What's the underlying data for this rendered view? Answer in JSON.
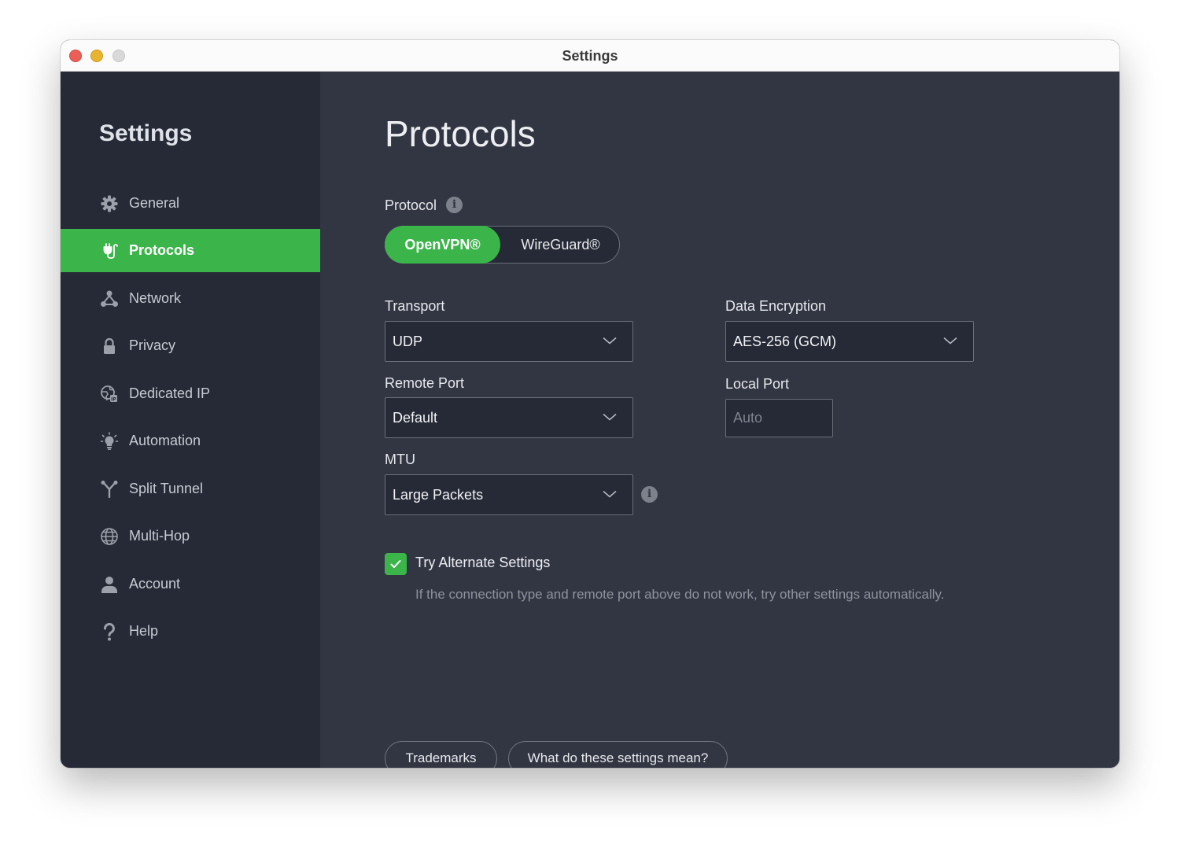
{
  "window": {
    "title": "Settings"
  },
  "sidebar": {
    "title": "Settings",
    "items": [
      {
        "label": "General",
        "icon": "gear-icon"
      },
      {
        "label": "Protocols",
        "icon": "plug-icon",
        "active": true
      },
      {
        "label": "Network",
        "icon": "network-icon"
      },
      {
        "label": "Privacy",
        "icon": "lock-icon"
      },
      {
        "label": "Dedicated IP",
        "icon": "dedicated-ip-icon"
      },
      {
        "label": "Automation",
        "icon": "lightbulb-icon"
      },
      {
        "label": "Split Tunnel",
        "icon": "split-icon"
      },
      {
        "label": "Multi-Hop",
        "icon": "globe-icon"
      },
      {
        "label": "Account",
        "icon": "user-icon"
      },
      {
        "label": "Help",
        "icon": "question-icon"
      }
    ]
  },
  "main": {
    "title": "Protocols",
    "protocol": {
      "label": "Protocol",
      "options": [
        "OpenVPN®",
        "WireGuard®"
      ],
      "selected": "OpenVPN®"
    },
    "transport": {
      "label": "Transport",
      "value": "UDP"
    },
    "data_encryption": {
      "label": "Data Encryption",
      "value": "AES-256 (GCM)"
    },
    "remote_port": {
      "label": "Remote Port",
      "value": "Default"
    },
    "local_port": {
      "label": "Local Port",
      "placeholder": "Auto"
    },
    "mtu": {
      "label": "MTU",
      "value": "Large Packets"
    },
    "alternate": {
      "label": "Try Alternate Settings",
      "checked": true,
      "hint": "If the connection type and remote port above do not work, try other settings automatically."
    },
    "buttons": {
      "trademarks": "Trademarks",
      "explain": "What do these settings mean?"
    }
  },
  "colors": {
    "accent": "#3bb54a",
    "sidebar_bg": "#262a36",
    "content_bg": "#323643"
  }
}
